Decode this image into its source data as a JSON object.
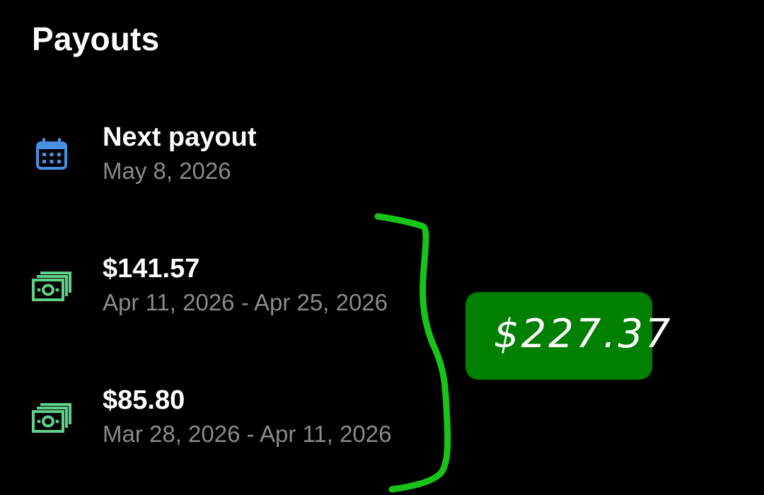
{
  "header": {
    "title": "Payouts"
  },
  "next_payout": {
    "label": "Next payout",
    "date": "May 8, 2026",
    "icon": "calendar-icon",
    "icon_color": "#4a90e2"
  },
  "payouts": [
    {
      "amount": "$141.57",
      "period": "Apr 11, 2026 - Apr 25, 2026",
      "icon": "cash-icon"
    },
    {
      "amount": "$85.80",
      "period": "Mar 28, 2026 - Apr 11, 2026",
      "icon": "cash-icon"
    }
  ],
  "annotation": {
    "total": "$227.37",
    "badge_color": "#008000",
    "brace_color": "#19c419"
  },
  "colors": {
    "background": "#000000",
    "text_primary": "#ffffff",
    "text_secondary": "#8a8a8a",
    "cash_icon": "#5fd08a"
  }
}
